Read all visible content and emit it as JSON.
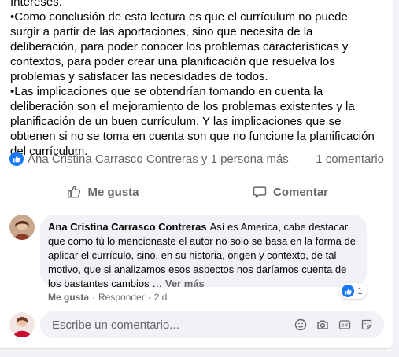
{
  "post": {
    "paragraphs": [
      "Intereses.",
      "•Como conclusión de esta lectura es que el currículum no puede surgir a partir de las aportaciones, sino que necesita de la deliberación, para poder conocer los problemas características y contextos, para poder crear una planificación que resuelva los problemas y satisfacer las necesidades de todos.",
      "•Las implicaciones que se obtendrían tomando en cuenta la deliberación son el mejoramiento de los problemas existentes y la planificación de un buen currículum. Y las implicaciones que se obtienen si no se toma en cuenta son que no funcione la planificación del currículum."
    ]
  },
  "reactions": {
    "names": "Ana Cristina Carrasco Contreras y 1 persona más",
    "comments_count": "1 comentario",
    "icon": "like-icon",
    "color": "#1877f2"
  },
  "actions": {
    "like_label": "Me gusta",
    "comment_label": "Comentar"
  },
  "comment": {
    "author": "Ana Cristina Carrasco Contreras",
    "text": "Así es America, cabe destacar que como tú lo mencionaste el autor no solo se basa en la forma de aplicar el currículo, sino, en su historia, origen y contexto, de tal motivo, que si analizamos esos aspectos nos daríamos cuenta de los bastantes cambios …",
    "see_more": "Ver más",
    "like_link": "Me gusta",
    "reply_link": "Responder",
    "time": "2 d",
    "like_count": "1"
  },
  "composer": {
    "placeholder": "Escribe un comentario...",
    "icons": [
      "emoji-icon",
      "camera-icon",
      "gif-icon",
      "sticker-icon"
    ]
  }
}
